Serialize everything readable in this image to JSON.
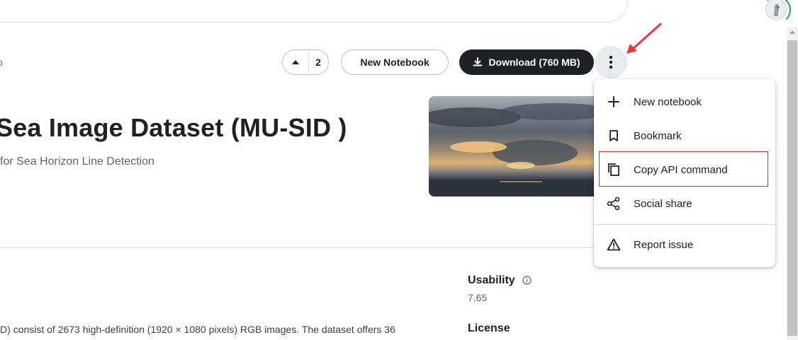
{
  "header": {
    "truncated_breadcrumb": "o"
  },
  "actions": {
    "vote_count": "2",
    "new_notebook_label": "New Notebook",
    "download_label": "Download (760 MB)"
  },
  "dataset": {
    "title": "Sea Image Dataset (MU-SID )",
    "subtitle": "for Sea Horizon Line Detection",
    "description": "D) consist of 2673 high-definition (1920 × 1080 pixels) RGB images. The dataset offers 36"
  },
  "sidebar": {
    "usability_label": "Usability",
    "usability_value": "7.65",
    "license_label": "License"
  },
  "menu": {
    "items": [
      {
        "label": "New notebook",
        "icon": "plus-icon"
      },
      {
        "label": "Bookmark",
        "icon": "bookmark-icon"
      },
      {
        "label": "Copy API command",
        "icon": "copy-icon"
      },
      {
        "label": "Social share",
        "icon": "share-icon"
      },
      {
        "label": "Report issue",
        "icon": "warning-icon"
      }
    ]
  },
  "colors": {
    "primary_dark": "#202124",
    "highlight_red": "#d32f2f",
    "annotation_arrow": "#e53935"
  }
}
